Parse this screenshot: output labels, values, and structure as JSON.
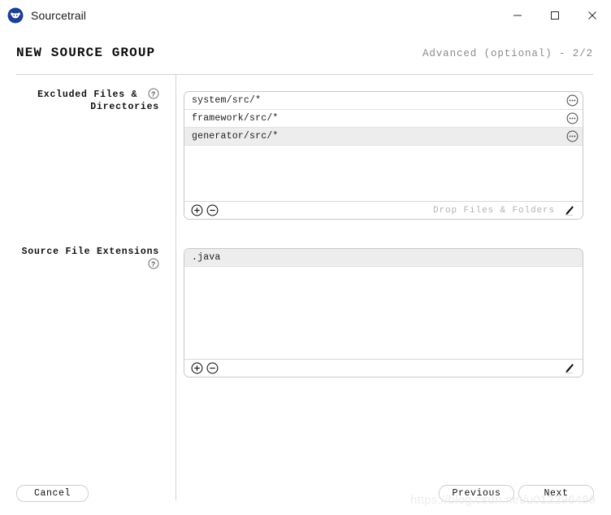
{
  "window": {
    "title": "Sourcetrail",
    "icon": "sourcetrail-bull-icon",
    "controls": {
      "minimize": "minimize-icon",
      "maximize": "maximize-icon",
      "close": "close-icon"
    }
  },
  "header": {
    "page_title": "NEW SOURCE GROUP",
    "step_label": "Advanced (optional) - 2/2"
  },
  "fields": [
    {
      "label_line1": "Excluded Files &",
      "label_line2": "Directories",
      "help_icon": "help-circle-icon",
      "items": [
        {
          "text": "system/src/*",
          "alt": false,
          "button_icon": "ellipsis-circle-icon"
        },
        {
          "text": "framework/src/*",
          "alt": false,
          "button_icon": "ellipsis-circle-icon"
        },
        {
          "text": "generator/src/*",
          "alt": true,
          "button_icon": "ellipsis-circle-icon"
        }
      ],
      "footer": {
        "add_icon": "plus-circle-icon",
        "remove_icon": "minus-circle-icon",
        "drop_hint": "Drop Files & Folders",
        "edit_icon": "pencil-icon"
      }
    },
    {
      "label_line1": "Source File Extensions",
      "label_line2": "",
      "help_icon": "help-circle-icon",
      "items": [
        {
          "text": ".java",
          "alt": true,
          "button_icon": ""
        }
      ],
      "footer": {
        "add_icon": "plus-circle-icon",
        "remove_icon": "minus-circle-icon",
        "drop_hint": "",
        "edit_icon": "pencil-icon"
      }
    }
  ],
  "footer": {
    "cancel_label": "Cancel",
    "previous_label": "Previous",
    "next_label": "Next"
  },
  "watermark": "https://blog.csdn.net/u012296499",
  "colors": {
    "accent": "#1d3f94",
    "border": "#c8c8c8",
    "rule": "#d2d2d2",
    "alt_row": "#ededed",
    "muted_text": "#8a8a8a"
  }
}
